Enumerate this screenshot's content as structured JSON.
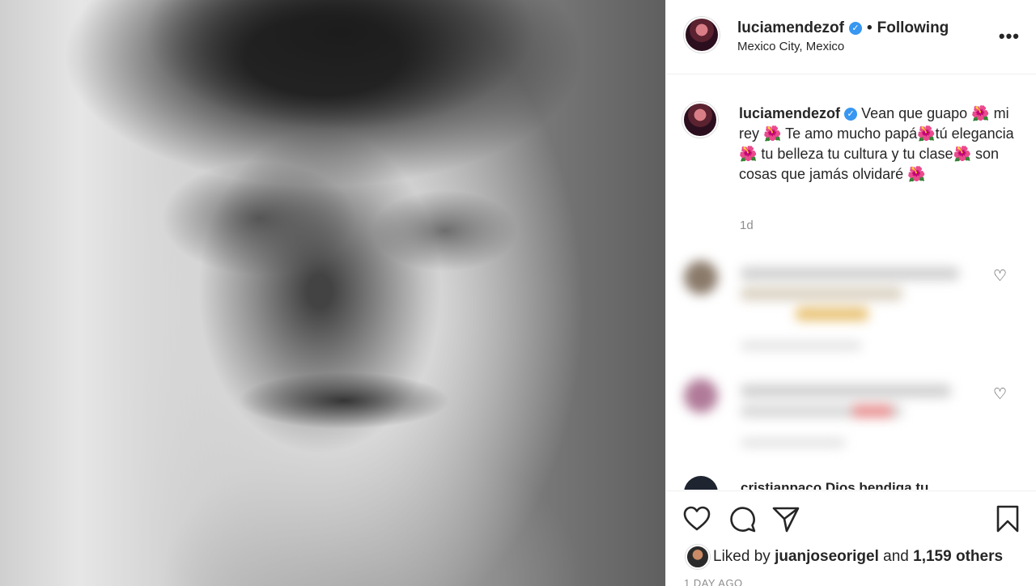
{
  "post": {
    "username": "luciamendezof",
    "follow_separator": "•",
    "follow_status": "Following",
    "location": "Mexico City, Mexico",
    "more_label": "•••"
  },
  "caption": {
    "username": "luciamendezof",
    "text": "Vean que guapo 🌺 mi rey 🌺 Te amo mucho papá🌺tú elegancia🌺 tu belleza tu cultura y tu clase🌺 son cosas que jamás olvidaré 🌺",
    "time": "1d"
  },
  "comments": {
    "peek_text": "cristianpaco Dios bendiga tu"
  },
  "likes": {
    "prefix": "Liked by",
    "user": "juanjoseorigel",
    "conjunction": "and",
    "count": "1,159 others"
  },
  "timestamp": "1 DAY AGO",
  "icons": {
    "verified": "verified-badge",
    "more": "more-options-icon",
    "like": "heart-icon",
    "comment": "comment-bubble-icon",
    "share": "send-icon",
    "save": "bookmark-icon"
  },
  "colors": {
    "verified_blue": "#3897f0",
    "text": "#262626",
    "secondary": "#8e8e8e",
    "divider": "#efefef"
  }
}
